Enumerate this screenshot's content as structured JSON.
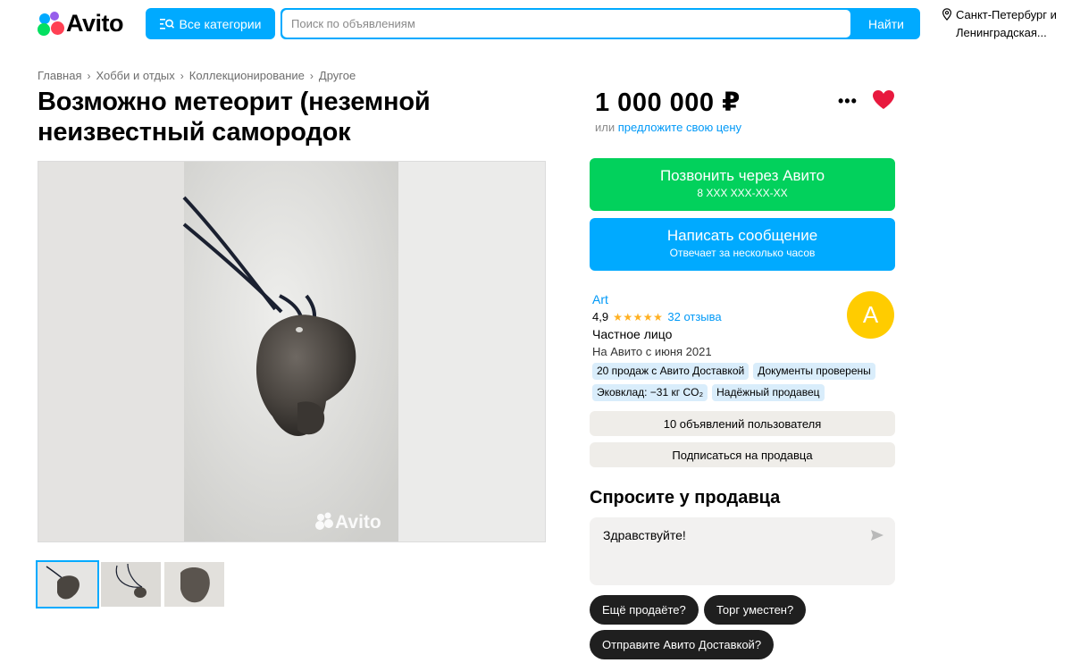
{
  "header": {
    "logo_text": "Avito",
    "categories_label": "Все категории",
    "search_placeholder": "Поиск по объявлениям",
    "search_button": "Найти",
    "location_line1": "Санкт-Петербург и",
    "location_line2": "Ленинградская..."
  },
  "breadcrumb": [
    "Главная",
    "Хобби и отдых",
    "Коллекционирование",
    "Другое"
  ],
  "listing": {
    "title": "Возможно метеорит (неземной неизвестный самородок",
    "price": "1 000 000 ₽",
    "price_prefix": "или",
    "price_link": "предложите свою цену",
    "watermark": "Avito"
  },
  "actions": {
    "call_label": "Позвонить через Авито",
    "call_phone": "8 XXX XXX-XX-XX",
    "message_label": "Написать сообщение",
    "message_sub": "Отвечает за несколько часов"
  },
  "seller": {
    "name": "Art",
    "rating": "4,9",
    "stars": "★★★★★",
    "reviews": "32 отзыва",
    "type": "Частное лицо",
    "since": "На Авито с июня 2021",
    "avatar_letter": "A",
    "badges": [
      "20 продаж с Авито Доставкой",
      "Документы проверены",
      "Эковклад: −31 кг CO₂",
      "Надёжный продавец"
    ],
    "listings_button": "10 объявлений пользователя",
    "subscribe_button": "Подписаться на продавца"
  },
  "ask": {
    "title": "Спросите у продавца",
    "message": "Здравствуйте!",
    "chips": [
      "Ещё продаёте?",
      "Торг уместен?",
      "Отправите Авито Доставкой?"
    ]
  },
  "colors": {
    "accent_blue": "#00aaff",
    "call_green": "#02d15c",
    "heart_red": "#e8193e",
    "avatar_yellow": "#ffcc00"
  }
}
